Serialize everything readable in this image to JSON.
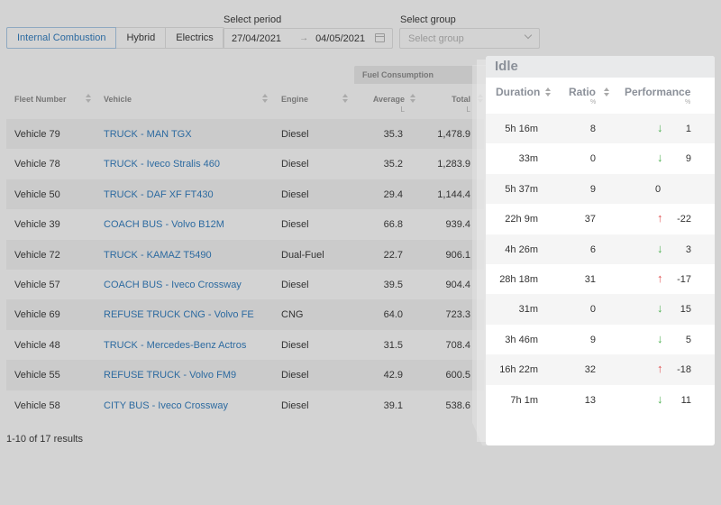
{
  "engine_tabs": [
    {
      "label": "Internal Combustion",
      "active": true
    },
    {
      "label": "Hybrid",
      "active": false
    },
    {
      "label": "Electrics",
      "active": false
    }
  ],
  "period": {
    "label": "Select period",
    "start": "27/04/2021",
    "end": "04/05/2021",
    "separator": "→",
    "icon": "calendar-icon"
  },
  "group": {
    "label": "Select group",
    "placeholder": "Select group",
    "icon": "chevron-down-icon"
  },
  "table": {
    "group_header": "Fuel Consumption",
    "columns": {
      "fleet": "Fleet Number",
      "vehicle": "Vehicle",
      "engine": "Engine",
      "average": "Average",
      "average_unit": "L",
      "total": "Total",
      "total_unit": "L"
    },
    "rows": [
      {
        "fleet": "Vehicle 79",
        "vehicle": "TRUCK - MAN TGX",
        "engine": "Diesel",
        "average": "35.3",
        "total": "1,478.9"
      },
      {
        "fleet": "Vehicle 78",
        "vehicle": "TRUCK - Iveco Stralis 460",
        "engine": "Diesel",
        "average": "35.2",
        "total": "1,283.9"
      },
      {
        "fleet": "Vehicle 50",
        "vehicle": "TRUCK - DAF XF FT430",
        "engine": "Diesel",
        "average": "29.4",
        "total": "1,144.4"
      },
      {
        "fleet": "Vehicle 39",
        "vehicle": "COACH BUS - Volvo B12M",
        "engine": "Diesel",
        "average": "66.8",
        "total": "939.4"
      },
      {
        "fleet": "Vehicle 72",
        "vehicle": "TRUCK - KAMAZ T5490",
        "engine": "Dual-Fuel",
        "average": "22.7",
        "total": "906.1"
      },
      {
        "fleet": "Vehicle 57",
        "vehicle": "COACH BUS - Iveco Crossway",
        "engine": "Diesel",
        "average": "39.5",
        "total": "904.4"
      },
      {
        "fleet": "Vehicle 69",
        "vehicle": "REFUSE TRUCK CNG - Volvo FE",
        "engine": "CNG",
        "average": "64.0",
        "total": "723.3"
      },
      {
        "fleet": "Vehicle 48",
        "vehicle": "TRUCK - Mercedes-Benz Actros",
        "engine": "Diesel",
        "average": "31.5",
        "total": "708.4"
      },
      {
        "fleet": "Vehicle 55",
        "vehicle": "REFUSE TRUCK - Volvo FM9",
        "engine": "Diesel",
        "average": "42.9",
        "total": "600.5"
      },
      {
        "fleet": "Vehicle 58",
        "vehicle": "CITY BUS - Iveco Crossway",
        "engine": "Diesel",
        "average": "39.1",
        "total": "538.6"
      }
    ],
    "pagination": "1-10 of 17 results"
  },
  "idle": {
    "title": "Idle",
    "columns": {
      "duration": "Duration",
      "ratio": "Ratio",
      "ratio_unit": "%",
      "performance": "Performance",
      "performance_unit": "%"
    },
    "rows": [
      {
        "duration": "5h 16m",
        "ratio": "8",
        "trend": "down",
        "performance": "1"
      },
      {
        "duration": "33m",
        "ratio": "0",
        "trend": "down",
        "performance": "9"
      },
      {
        "duration": "5h 37m",
        "ratio": "9",
        "trend": "none",
        "performance": "0"
      },
      {
        "duration": "22h 9m",
        "ratio": "37",
        "trend": "up",
        "performance": "-22"
      },
      {
        "duration": "4h 26m",
        "ratio": "6",
        "trend": "down",
        "performance": "3"
      },
      {
        "duration": "28h 18m",
        "ratio": "31",
        "trend": "up",
        "performance": "-17"
      },
      {
        "duration": "31m",
        "ratio": "0",
        "trend": "down",
        "performance": "15"
      },
      {
        "duration": "3h 46m",
        "ratio": "9",
        "trend": "down",
        "performance": "5"
      },
      {
        "duration": "16h 22m",
        "ratio": "32",
        "trend": "up",
        "performance": "-18"
      },
      {
        "duration": "7h 1m",
        "ratio": "13",
        "trend": "down",
        "performance": "11"
      }
    ],
    "colors": {
      "down": "#4caf50",
      "up": "#e05252"
    }
  }
}
